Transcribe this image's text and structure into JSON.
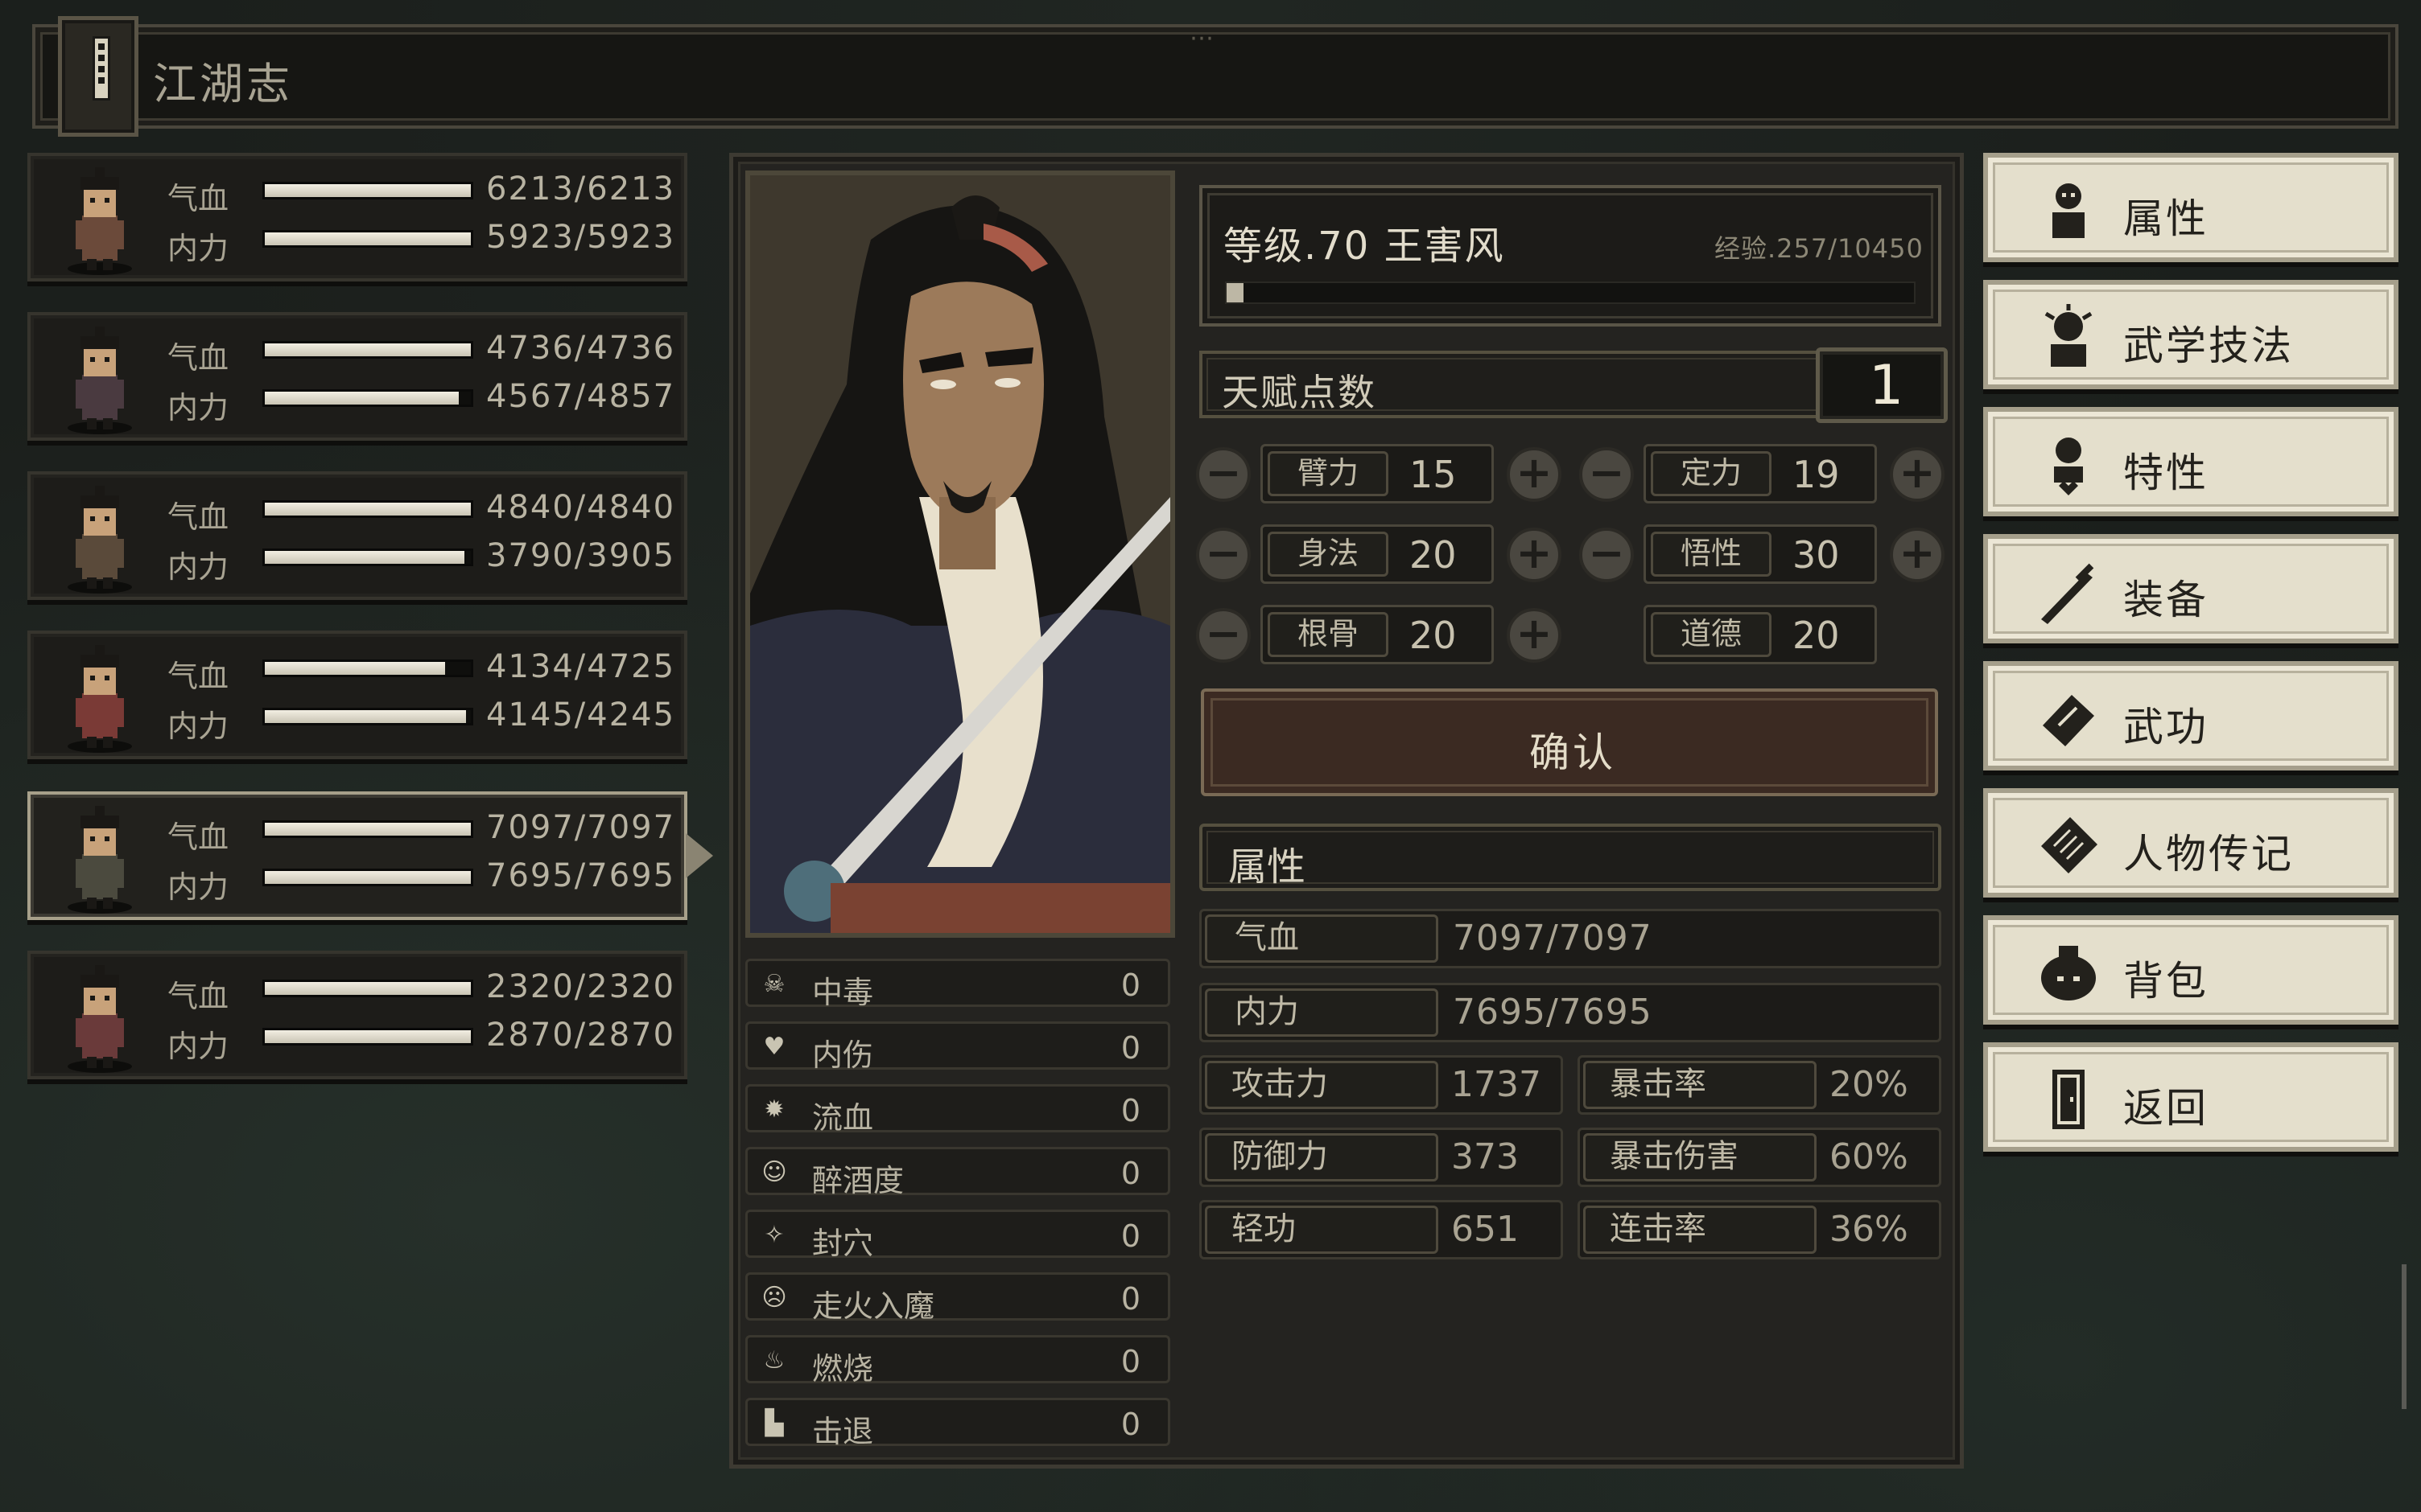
{
  "header": {
    "title": "江湖志"
  },
  "party": [
    {
      "hp_label": "气血",
      "hp": "6213/6213",
      "hp_frac": 1.0,
      "mp_label": "内力",
      "mp": "5923/5923",
      "mp_frac": 1.0,
      "selected": false
    },
    {
      "hp_label": "气血",
      "hp": "4736/4736",
      "hp_frac": 1.0,
      "mp_label": "内力",
      "mp": "4567/4857",
      "mp_frac": 0.94,
      "selected": false
    },
    {
      "hp_label": "气血",
      "hp": "4840/4840",
      "hp_frac": 1.0,
      "mp_label": "内力",
      "mp": "3790/3905",
      "mp_frac": 0.97,
      "selected": false
    },
    {
      "hp_label": "气血",
      "hp": "4134/4725",
      "hp_frac": 0.875,
      "mp_label": "内力",
      "mp": "4145/4245",
      "mp_frac": 0.976,
      "selected": false
    },
    {
      "hp_label": "气血",
      "hp": "7097/7097",
      "hp_frac": 1.0,
      "mp_label": "内力",
      "mp": "7695/7695",
      "mp_frac": 1.0,
      "selected": true
    },
    {
      "hp_label": "气血",
      "hp": "2320/2320",
      "hp_frac": 1.0,
      "mp_label": "内力",
      "mp": "2870/2870",
      "mp_frac": 1.0,
      "selected": false
    }
  ],
  "character": {
    "level_line": "等级.70  王害风",
    "exp_text": "经验.257/10450",
    "exp_frac": 0.025
  },
  "talent": {
    "label": "天赋点数",
    "value": "1"
  },
  "attributes": {
    "arm": {
      "name": "臂力",
      "value": "15"
    },
    "focus": {
      "name": "定力",
      "value": "19"
    },
    "agility": {
      "name": "身法",
      "value": "20"
    },
    "insight": {
      "name": "悟性",
      "value": "30"
    },
    "constitution": {
      "name": "根骨",
      "value": "20"
    },
    "morality": {
      "name": "道德",
      "value": "20"
    }
  },
  "confirm_label": "确认",
  "status_effects": [
    {
      "icon": "skull-icon",
      "glyph": "☠",
      "label": "中毒",
      "value": "0"
    },
    {
      "icon": "broken-heart-icon",
      "glyph": "♥",
      "label": "内伤",
      "value": "0"
    },
    {
      "icon": "blood-splat-icon",
      "glyph": "✹",
      "label": "流血",
      "value": "0"
    },
    {
      "icon": "drunk-face-icon",
      "glyph": "☺",
      "label": "醉酒度",
      "value": "0"
    },
    {
      "icon": "pressure-point-icon",
      "glyph": "✧",
      "label": "封穴",
      "value": "0"
    },
    {
      "icon": "angry-face-icon",
      "glyph": "☹",
      "label": "走火入魔",
      "value": "0"
    },
    {
      "icon": "flame-icon",
      "glyph": "♨",
      "label": "燃烧",
      "value": "0"
    },
    {
      "icon": "boot-icon",
      "glyph": "▙",
      "label": "击退",
      "value": "0"
    }
  ],
  "stats": {
    "section_title": "属性",
    "hp": {
      "label": "气血",
      "value": "7097/7097"
    },
    "mp": {
      "label": "内力",
      "value": "7695/7695"
    },
    "attack": {
      "label": "攻击力",
      "value": "1737"
    },
    "crit_rate": {
      "label": "暴击率",
      "value": "20%"
    },
    "defense": {
      "label": "防御力",
      "value": "373"
    },
    "crit_dmg": {
      "label": "暴击伤害",
      "value": "60%"
    },
    "lightness": {
      "label": "轻功",
      "value": "651"
    },
    "combo_rate": {
      "label": "连击率",
      "value": "36%"
    }
  },
  "menu": [
    {
      "icon": "person-attributes-icon",
      "label": "属性"
    },
    {
      "icon": "martial-skills-icon",
      "label": "武学技法"
    },
    {
      "icon": "traits-icon",
      "label": "特性"
    },
    {
      "icon": "sword-equipment-icon",
      "label": "装备"
    },
    {
      "icon": "manual-book-icon",
      "label": "武功"
    },
    {
      "icon": "biography-scroll-icon",
      "label": "人物传记"
    },
    {
      "icon": "backpack-icon",
      "label": "背包"
    },
    {
      "icon": "door-return-icon",
      "label": "返回"
    }
  ],
  "colors": {
    "accent": "#a7a08a",
    "panel": "#242320",
    "menu_bg": "#e4dfcc",
    "confirm_bg": "#3b2a22"
  }
}
